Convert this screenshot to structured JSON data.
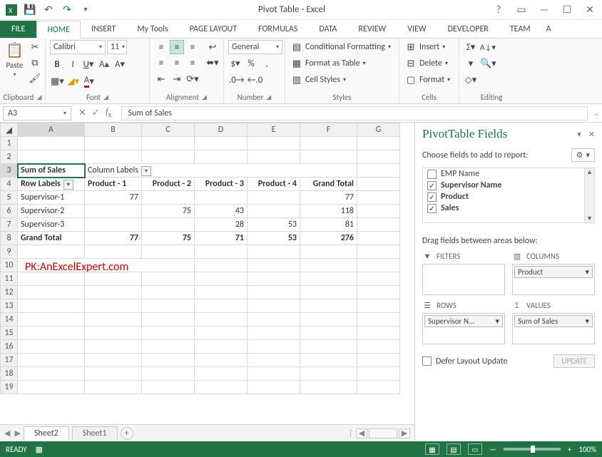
{
  "titlebar": {
    "title": "Pivot Table - Excel"
  },
  "tabs": {
    "file": "FILE",
    "home": "HOME",
    "insert": "INSERT",
    "mytools": "My Tools",
    "pagelayout": "PAGE LAYOUT",
    "formulas": "FORMULAS",
    "data": "DATA",
    "review": "REVIEW",
    "view": "VIEW",
    "developer": "DEVELOPER",
    "team": "TEAM",
    "overflow": "A"
  },
  "ribbon": {
    "clipboard": {
      "label": "Clipboard",
      "paste": "Paste"
    },
    "font": {
      "label": "Font",
      "name": "Calibri",
      "size": "11"
    },
    "alignment": {
      "label": "Alignment"
    },
    "number": {
      "label": "Number",
      "format": "General"
    },
    "styles": {
      "label": "Styles",
      "cond": "Conditional Formatting",
      "table": "Format as Table",
      "cell": "Cell Styles"
    },
    "cells": {
      "label": "Cells",
      "insert": "Insert",
      "delete": "Delete",
      "format": "Format"
    },
    "editing": {
      "label": "Editing"
    }
  },
  "formula_bar": {
    "cellref": "A3",
    "value": "Sum of Sales"
  },
  "columns": [
    "A",
    "B",
    "C",
    "D",
    "E",
    "F",
    "G"
  ],
  "cells": {
    "a3": "Sum of Sales",
    "b3": "Column Labels",
    "a4": "Row Labels",
    "b4": "Product - 1",
    "c4": "Product - 2",
    "d4": "Product - 3",
    "e4": "Product - 4",
    "f4": "Grand Total",
    "a5": "Supervisor-1",
    "b5": "77",
    "f5": "77",
    "a6": "Supervisor-2",
    "c6": "75",
    "d6": "43",
    "f6": "118",
    "a7": "Supervisor-3",
    "d7": "28",
    "e7": "53",
    "f7": "81",
    "a8": "Grand Total",
    "b8": "77",
    "c8": "75",
    "d8": "71",
    "e8": "53",
    "f8": "276"
  },
  "watermark": "PK:AnExcelExpert.com",
  "pivot": {
    "title": "PivotTable Fields",
    "subtitle": "Choose fields to add to report:",
    "fields": [
      {
        "label": "EMP Name",
        "checked": false
      },
      {
        "label": "Supervisor Name",
        "checked": true
      },
      {
        "label": "Product",
        "checked": true
      },
      {
        "label": "Sales",
        "checked": true
      }
    ],
    "dragtxt": "Drag fields between areas below:",
    "areas": {
      "filters": "FILTERS",
      "columns": "COLUMNS",
      "rows": "ROWS",
      "values": "VALUES",
      "col_chip": "Product",
      "row_chip": "Supervisor N...",
      "val_chip": "Sum of Sales"
    },
    "defer": "Defer Layout Update",
    "update": "UPDATE"
  },
  "sheets": {
    "s2": "Sheet2",
    "s1": "Sheet1"
  },
  "status": {
    "ready": "READY",
    "zoom": "100%"
  }
}
